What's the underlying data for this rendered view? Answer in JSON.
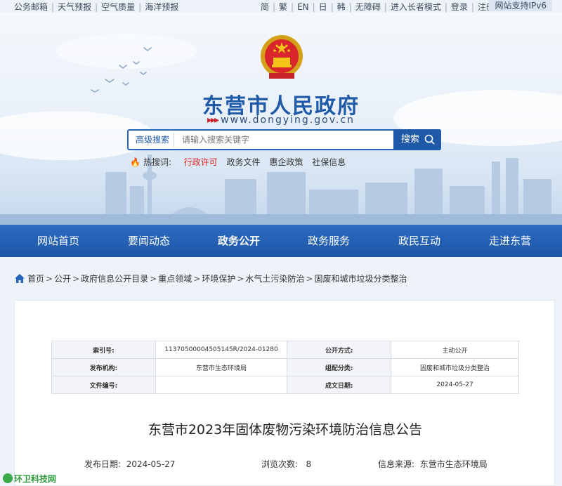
{
  "topbar": {
    "left_links": [
      "公务邮箱",
      "天气预报",
      "空气质量",
      "海洋预报"
    ],
    "right_links": [
      "简",
      "繁",
      "EN",
      "日",
      "韩",
      "无障碍",
      "进入长者模式",
      "登录",
      "注册"
    ],
    "ipv6": "网站支持IPv6"
  },
  "header": {
    "title": "东营市人民政府",
    "url": "www.dongying.gov.cn"
  },
  "search": {
    "advanced_label": "高级搜索",
    "placeholder": "请输入搜索关键字",
    "button_label": "搜索"
  },
  "hotwords": {
    "label": "热搜词:",
    "items": [
      "行政许可",
      "政务文件",
      "惠企政策",
      "社保信息"
    ]
  },
  "nav": {
    "items": [
      "网站首页",
      "要闻动态",
      "政务公开",
      "政务服务",
      "政民互动",
      "走进东营"
    ],
    "active": "政务公开"
  },
  "breadcrumb": [
    "首页",
    "公开",
    "政府信息公开目录",
    "重点领域",
    "环境保护",
    "水气土污染防治",
    "固废和城市垃圾分类整治"
  ],
  "meta": {
    "index_label": "索引号:",
    "index_value": "11370500004505145R/2024-01280",
    "mode_label": "公开方式:",
    "mode_value": "主动公开",
    "org_label": "发布机构:",
    "org_value": "东营市生态环境局",
    "category_label": "组配分类:",
    "category_value": "固废和城市垃圾分类整治",
    "docno_label": "文件编号:",
    "docno_value": "",
    "date_label": "成文日期:",
    "date_value": "2024-05-27"
  },
  "article": {
    "title": "东营市2023年固体废物污染环境防治信息公告",
    "publish_label": "发布日期:",
    "publish_date": "2024-05-27",
    "views_label": "浏览次数:",
    "views": "8",
    "source_label": "信息来源:",
    "source": "东营市生态环境局"
  },
  "watermark": "环卫科技网",
  "colors": {
    "brand_blue": "#1e5aa8",
    "nav_blue": "#2a66b8",
    "hot_red": "#e0211c"
  }
}
